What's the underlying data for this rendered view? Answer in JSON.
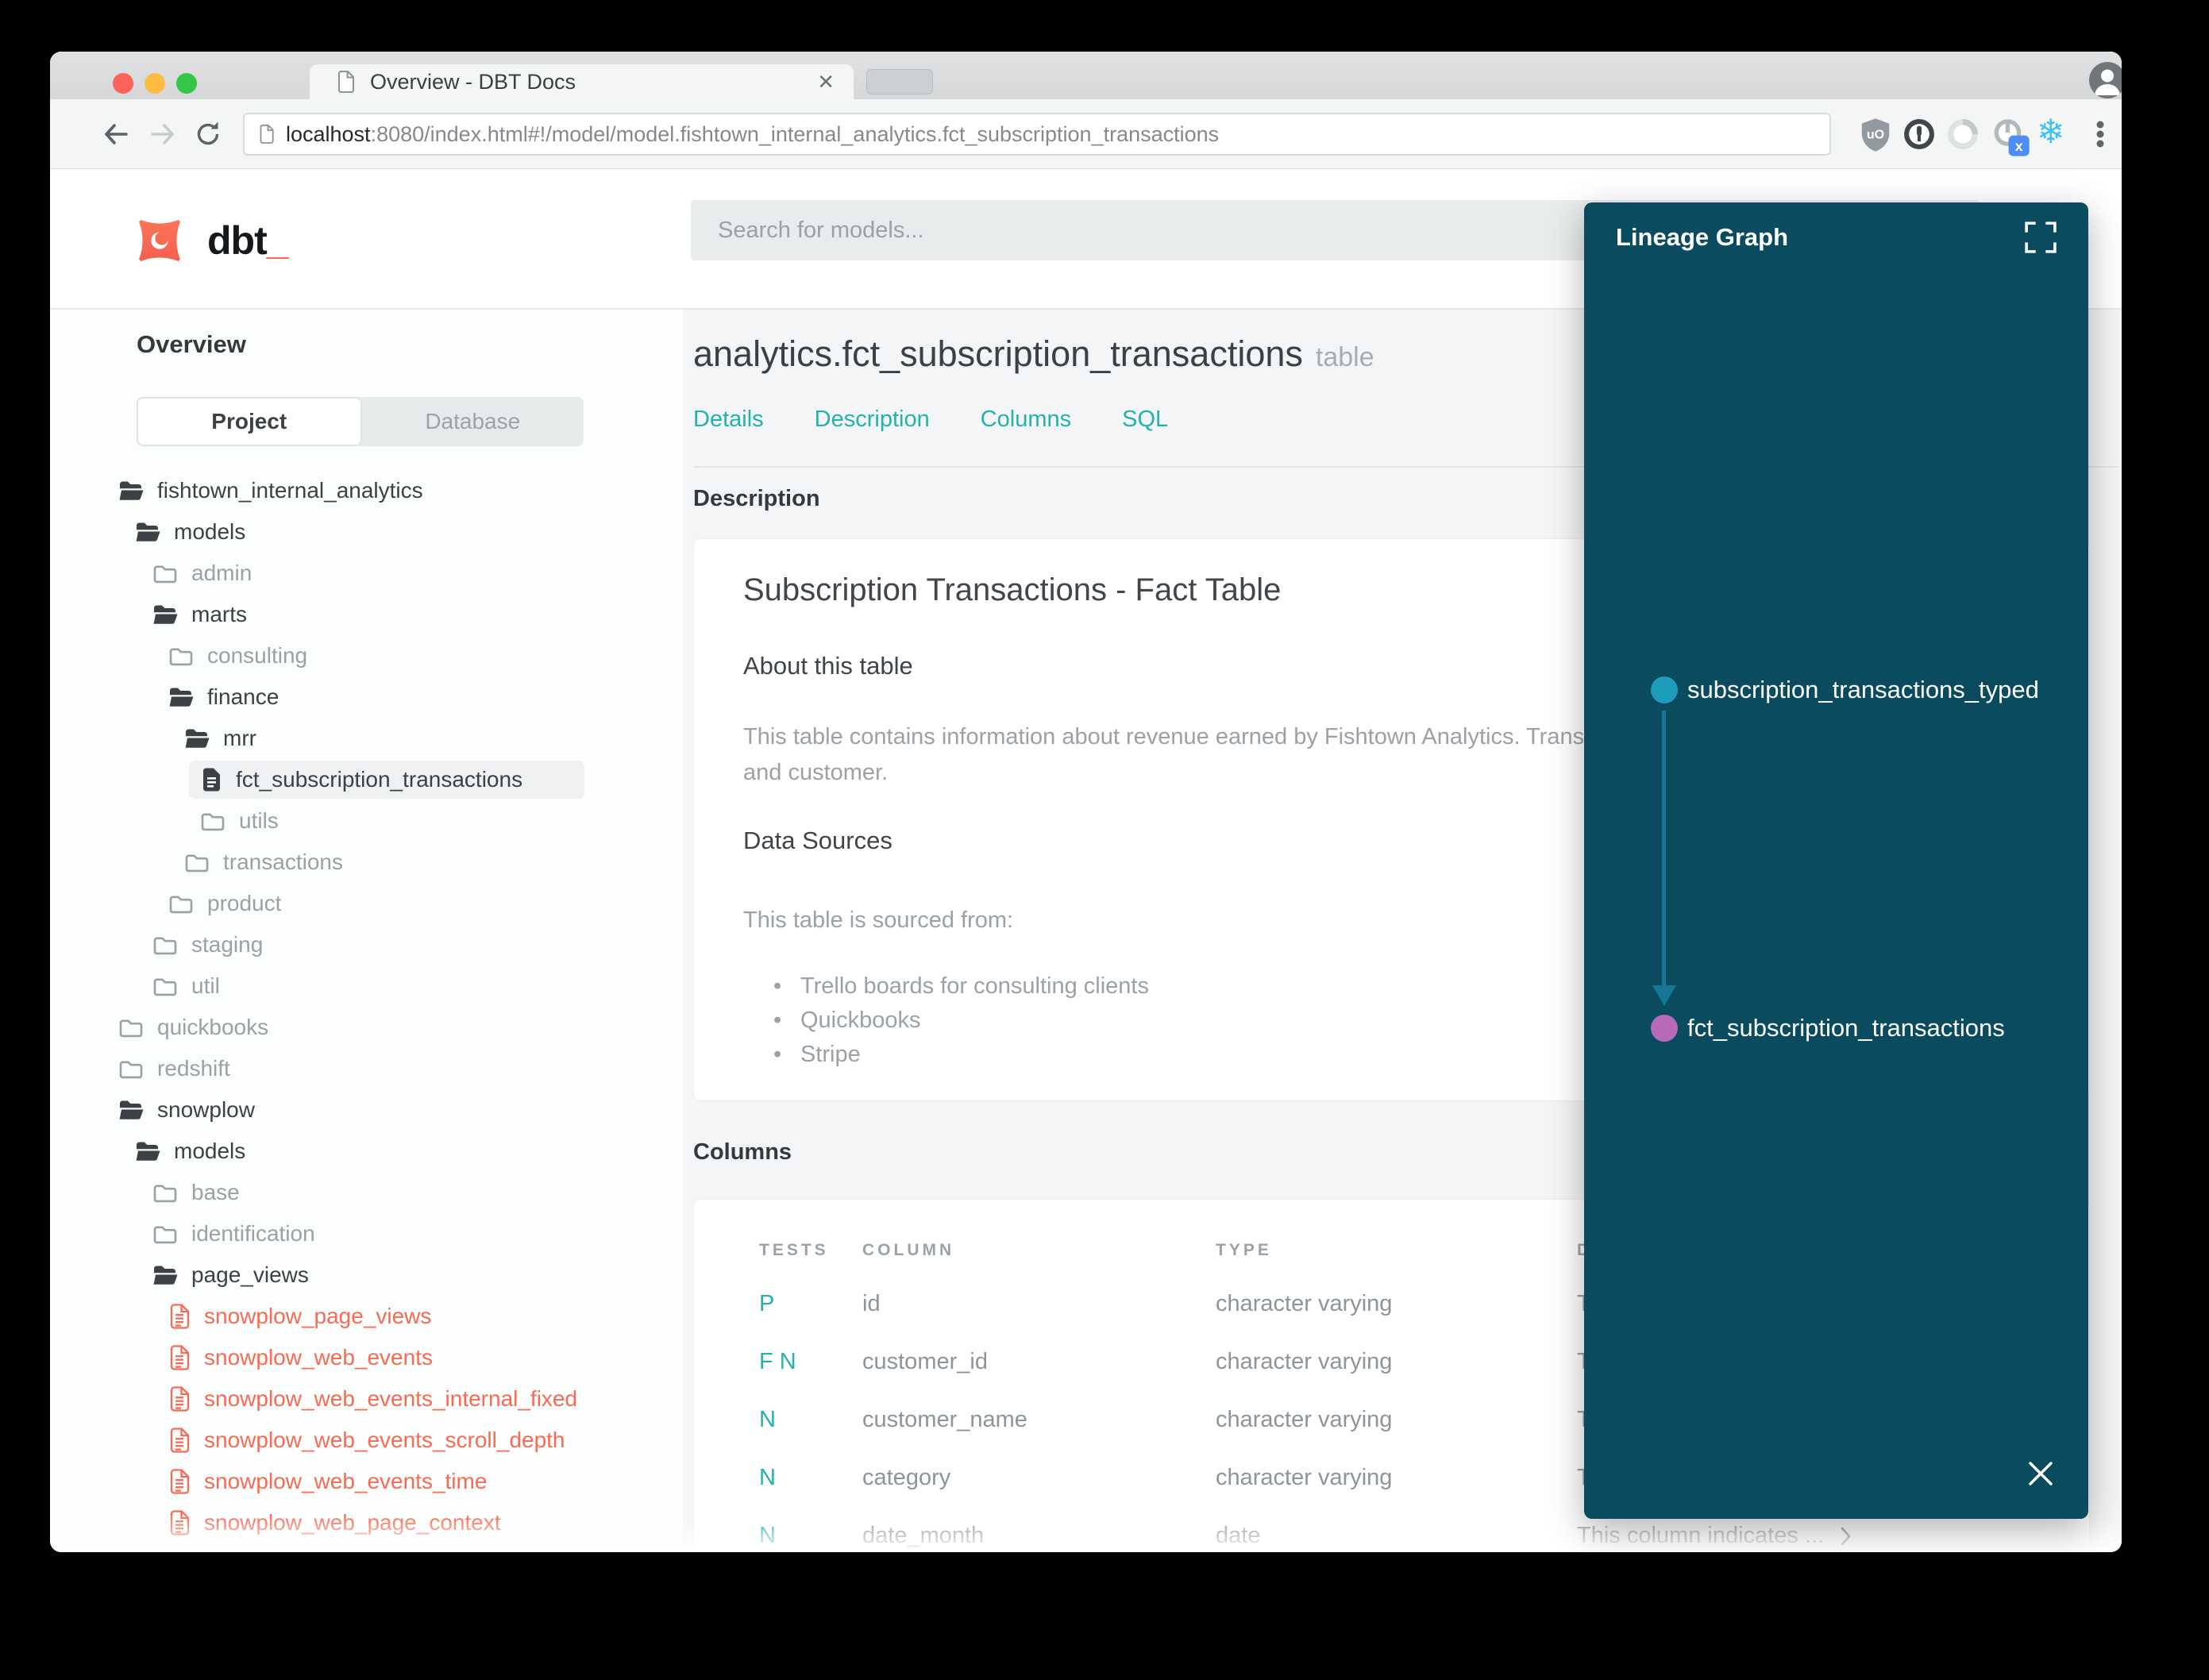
{
  "browser": {
    "tab_title": "Overview - DBT Docs",
    "url_host": "localhost",
    "url_rest": ":8080/index.html#!/model/model.fishtown_internal_analytics.fct_subscription_transactions"
  },
  "header": {
    "logo_text": "dbt",
    "logo_underscore": "_",
    "search_placeholder": "Search for models..."
  },
  "sidebar": {
    "title": "Overview",
    "tabs": {
      "project": "Project",
      "database": "Database"
    },
    "tree": [
      {
        "label": "fishtown_internal_analytics",
        "cls": "lvl0 icon-folder-open"
      },
      {
        "label": "models",
        "cls": "lvl1 icon-folder-open"
      },
      {
        "label": "admin",
        "cls": "lvl2 muted icon-folder"
      },
      {
        "label": "marts",
        "cls": "lvl2 icon-folder-open"
      },
      {
        "label": "consulting",
        "cls": "lvl3 muted icon-folder"
      },
      {
        "label": "finance",
        "cls": "lvl3 icon-folder-open"
      },
      {
        "label": "mrr",
        "cls": "lvl4 icon-folder-open"
      },
      {
        "label": "fct_subscription_transactions",
        "cls": "lvl5 icon-file selected"
      },
      {
        "label": "utils",
        "cls": "lvl5 muted icon-folder"
      },
      {
        "label": "transactions",
        "cls": "lvl4 muted icon-folder"
      },
      {
        "label": "product",
        "cls": "lvl3 muted icon-folder"
      },
      {
        "label": "staging",
        "cls": "lvl2 muted icon-folder"
      },
      {
        "label": "util",
        "cls": "lvl2 muted icon-folder"
      },
      {
        "label": "quickbooks",
        "cls": "lvl0 muted icon-folder"
      },
      {
        "label": "redshift",
        "cls": "lvl0 muted icon-folder"
      },
      {
        "label": "snowplow",
        "cls": "lvl0 icon-folder-open"
      },
      {
        "label": "models",
        "cls": "lvl1 icon-folder-open"
      },
      {
        "label": "base",
        "cls": "lvl2 muted icon-folder"
      },
      {
        "label": "identification",
        "cls": "lvl2 muted icon-folder"
      },
      {
        "label": "page_views",
        "cls": "lvl2 icon-folder-open"
      },
      {
        "label": "snowplow_page_views",
        "cls": "lvl3 red icon-file-red"
      },
      {
        "label": "snowplow_web_events",
        "cls": "lvl3 red icon-file-red"
      },
      {
        "label": "snowplow_web_events_internal_fixed",
        "cls": "lvl3 red icon-file-red"
      },
      {
        "label": "snowplow_web_events_scroll_depth",
        "cls": "lvl3 red icon-file-red"
      },
      {
        "label": "snowplow_web_events_time",
        "cls": "lvl3 red icon-file-red"
      },
      {
        "label": "snowplow_web_page_context",
        "cls": "lvl3 red icon-file-red"
      }
    ]
  },
  "main": {
    "title": "analytics.fct_subscription_transactions",
    "title_badge": "table",
    "nav": [
      "Details",
      "Description",
      "Columns",
      "SQL"
    ],
    "description_section": {
      "label": "Description",
      "heading": "Subscription Transactions - Fact Table",
      "about_heading": "About this table",
      "about_text": "This table contains information about revenue earned by Fishtown Analytics. Transactions are grouped by month, category, and customer.",
      "sources_heading": "Data Sources",
      "sources_intro": "This table is sourced from:",
      "sources": [
        "Trello boards for consulting clients",
        "Quickbooks",
        "Stripe"
      ]
    },
    "columns_section": {
      "label": "Columns",
      "headers": {
        "tests": "TESTS",
        "column": "COLUMN",
        "type": "TYPE",
        "description": "DESCRIPTION"
      },
      "rows": [
        {
          "tests": "P",
          "column": "id",
          "type": "character varying",
          "desc": "This column indicates ..."
        },
        {
          "tests": "F N",
          "column": "customer_id",
          "type": "character varying",
          "desc": "This column indicates ..."
        },
        {
          "tests": "N",
          "column": "customer_name",
          "type": "character varying",
          "desc": "This column indicates ..."
        },
        {
          "tests": "N",
          "column": "category",
          "type": "character varying",
          "desc": "This column indicates ..."
        },
        {
          "tests": "N",
          "column": "date_month",
          "type": "date",
          "desc": "This column indicates ..."
        }
      ]
    }
  },
  "lineage": {
    "title": "Lineage Graph",
    "nodes": [
      {
        "label": "subscription_transactions_typed",
        "color": "#1d9cbc"
      },
      {
        "label": "fct_subscription_transactions",
        "color": "#b76ab8"
      }
    ]
  },
  "colors": {
    "accent_teal": "#23b2ad",
    "brand_orange": "#ff5c49",
    "red_model": "#f96a53",
    "panel_bg": "#0a4b5f",
    "node_source": "#1d9cbc",
    "node_target": "#b76ab8"
  }
}
